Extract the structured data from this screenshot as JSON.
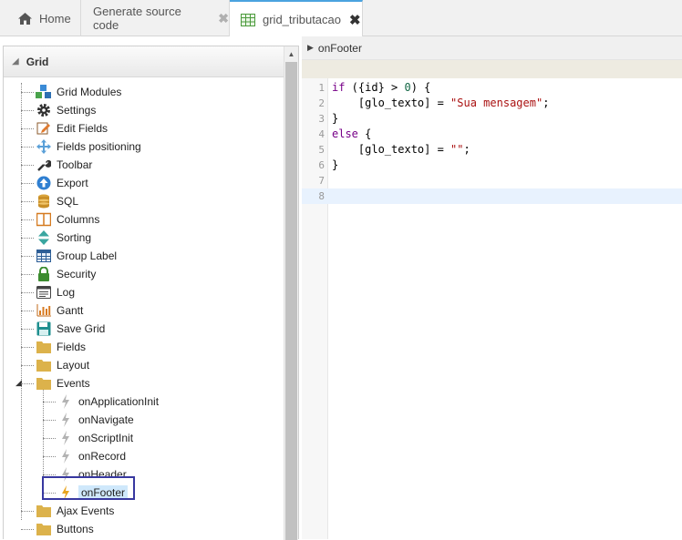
{
  "tabs": [
    {
      "label": "Home",
      "icon": "home-icon",
      "closable": false
    },
    {
      "label": "Generate source code",
      "icon": "",
      "closable": true
    },
    {
      "label": "grid_tributacao",
      "icon": "grid-table-icon",
      "closable": true,
      "active": true
    }
  ],
  "tree": {
    "header": "Grid",
    "items": [
      {
        "label": "Grid Modules",
        "icon": "cubes-icon"
      },
      {
        "label": "Settings",
        "icon": "gear-icon"
      },
      {
        "label": "Edit Fields",
        "icon": "edit-fields-icon"
      },
      {
        "label": "Fields positioning",
        "icon": "move-arrows-icon"
      },
      {
        "label": "Toolbar",
        "icon": "wrench-icon"
      },
      {
        "label": "Export",
        "icon": "export-arrow-icon"
      },
      {
        "label": "SQL",
        "icon": "database-icon"
      },
      {
        "label": "Columns",
        "icon": "columns-icon"
      },
      {
        "label": "Sorting",
        "icon": "sort-arrows-icon"
      },
      {
        "label": "Group Label",
        "icon": "table-icon"
      },
      {
        "label": "Security",
        "icon": "lock-icon"
      },
      {
        "label": "Log",
        "icon": "log-icon"
      },
      {
        "label": "Gantt",
        "icon": "gantt-chart-icon"
      },
      {
        "label": "Save Grid",
        "icon": "save-icon"
      },
      {
        "label": "Fields",
        "icon": "folder-icon"
      },
      {
        "label": "Layout",
        "icon": "folder-icon"
      },
      {
        "label": "Events",
        "icon": "folder-icon",
        "expanded": true
      },
      {
        "label": "Ajax Events",
        "icon": "folder-icon"
      },
      {
        "label": "Buttons",
        "icon": "folder-icon"
      }
    ],
    "events": [
      {
        "label": "onApplicationInit",
        "icon": "lightning-icon"
      },
      {
        "label": "onNavigate",
        "icon": "lightning-icon"
      },
      {
        "label": "onScriptInit",
        "icon": "lightning-icon"
      },
      {
        "label": "onRecord",
        "icon": "lightning-icon"
      },
      {
        "label": "onHeader",
        "icon": "lightning-icon"
      },
      {
        "label": "onFooter",
        "icon": "lightning-icon",
        "selected": true
      }
    ]
  },
  "editor": {
    "title": "onFooter",
    "line_numbers": [
      "1",
      "2",
      "3",
      "4",
      "5",
      "6",
      "7",
      "8"
    ],
    "active_line": 8
  },
  "colors": {
    "keyword": "#770088",
    "string": "#aa1111",
    "number": "#116644",
    "selection": "#3838a0",
    "active_tab_border": "#4aa3df"
  }
}
